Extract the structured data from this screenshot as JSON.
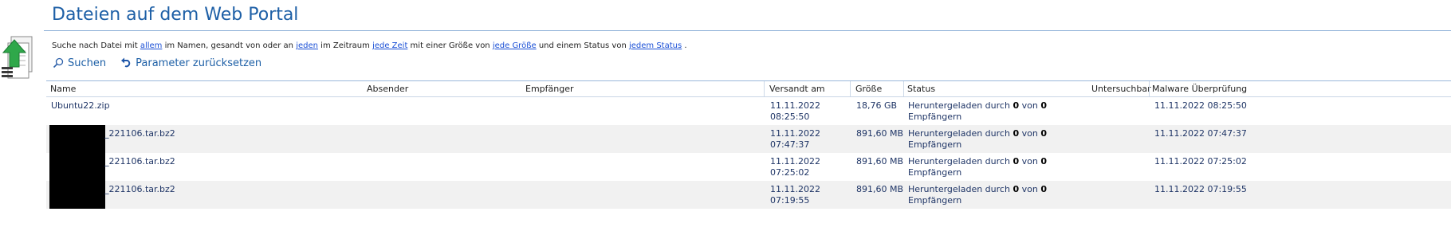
{
  "page": {
    "title": "Dateien auf dem Web Portal"
  },
  "filter": {
    "t1": "Suche nach Datei mit ",
    "l1": "allem",
    "t2": " im Namen, gesandt von oder an ",
    "l2": "jeden",
    "t3": " im Zeitraum ",
    "l3": "jede Zeit",
    "t4": " mit einer Größe von ",
    "l4": "jede Größe",
    "t5": " und einem Status von ",
    "l5": "jedem Status",
    "t6": " ."
  },
  "actions": {
    "search": "Suchen",
    "reset": "Parameter zurücksetzen"
  },
  "columns": {
    "name": "Name",
    "sender": "Absender",
    "recipient": "Empfänger",
    "sent": "Versandt am",
    "size": "Größe",
    "status": "Status",
    "examinable": "Untersuchbar",
    "malware": "Malware Überprüfung"
  },
  "rows": [
    {
      "name": "Ubuntu22.zip",
      "sent_date": "11.11.2022",
      "sent_time": "08:25:50",
      "size": "18,76 GB",
      "status_prefix": "Heruntergeladen durch ",
      "downloaded": "0",
      "status_mid": " von ",
      "total": "0",
      "status_suffix": "Empfängern",
      "malware": "11.11.2022 08:25:50"
    },
    {
      "name": "_221106.tar.bz2",
      "sent_date": "11.11.2022",
      "sent_time": "07:47:37",
      "size": "891,60 MB",
      "status_prefix": "Heruntergeladen durch ",
      "downloaded": "0",
      "status_mid": " von ",
      "total": "0",
      "status_suffix": "Empfängern",
      "malware": "11.11.2022 07:47:37"
    },
    {
      "name": "_221106.tar.bz2",
      "sent_date": "11.11.2022",
      "sent_time": "07:25:02",
      "size": "891,60 MB",
      "status_prefix": "Heruntergeladen durch ",
      "downloaded": "0",
      "status_mid": " von ",
      "total": "0",
      "status_suffix": "Empfängern",
      "malware": "11.11.2022 07:25:02"
    },
    {
      "name": "_221106.tar.bz2",
      "sent_date": "11.11.2022",
      "sent_time": "07:19:55",
      "size": "891,60 MB",
      "status_prefix": "Heruntergeladen durch ",
      "downloaded": "0",
      "status_mid": " von ",
      "total": "0",
      "status_suffix": "Empfängern",
      "malware": "11.11.2022 07:19:55"
    }
  ],
  "icons": {
    "portal": "upload-document-icon",
    "search": "search-icon",
    "reset": "reset-arrow-icon"
  },
  "colors": {
    "title": "#1d5fa6",
    "link": "#1a4fd6",
    "alt_row": "#f1f1f1"
  }
}
